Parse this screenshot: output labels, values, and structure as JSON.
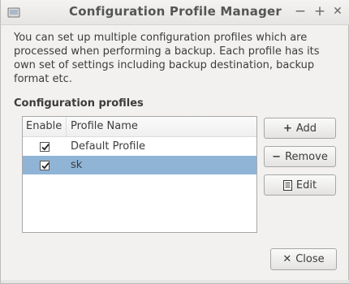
{
  "window": {
    "title": "Configuration Profile Manager",
    "minimize_glyph": "−",
    "maximize_glyph": "+",
    "close_glyph": "✕"
  },
  "intro_text": "You can set up multiple configuration profiles which are processed when performing a backup. Each profile has its own set of settings including backup destination, backup format etc.",
  "section_title": "Configuration profiles",
  "table": {
    "columns": [
      "Enable",
      "Profile Name"
    ],
    "rows": [
      {
        "enabled": true,
        "name": "Default Profile",
        "selected": false
      },
      {
        "enabled": true,
        "name": "sk",
        "selected": true
      }
    ]
  },
  "buttons": {
    "add": "Add",
    "remove": "Remove",
    "edit": "Edit",
    "close": "Close"
  },
  "colors": {
    "selection": "#8fb4d6",
    "window_bg": "#f2f1f0"
  }
}
